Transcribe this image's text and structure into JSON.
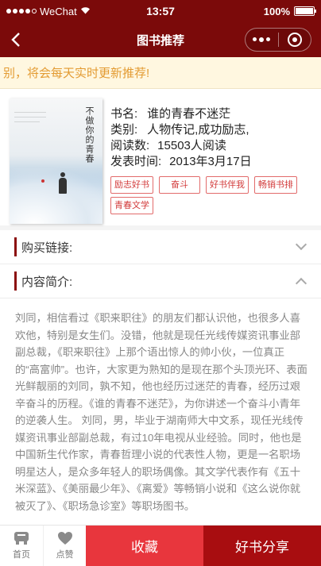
{
  "status_bar": {
    "carrier": "WeChat",
    "time": "13:57",
    "battery": "100%"
  },
  "nav": {
    "title": "图书推荐"
  },
  "notice": {
    "text": "别，将会每天实时更新推荐!"
  },
  "book": {
    "cover_title": "不做你的青春",
    "title_label": "书名:",
    "title": "谁的青春不迷茫",
    "category_label": "类别:",
    "category": "人物传记,成功励志,",
    "reads_label": "阅读数:",
    "reads": "15503人阅读",
    "date_label": "发表时间:",
    "date": "2013年3月17日",
    "tags": [
      "励志好书",
      "奋斗",
      "好书伴我",
      "畅销书排",
      "青春文学"
    ]
  },
  "sections": {
    "buy": "购买链接:",
    "intro": "内容简介:"
  },
  "summary": "刘同，相信看过《职来职往》的朋友们都认识他，也很多人喜欢他，特别是女生们。没错，他就是现任光线传媒资讯事业部副总裁，《职来职往》上那个语出惊人的帅小伙，一位真正的“高富帅”。也许，大家更为熟知的是现在那个头顶光环、表面光鲜靓丽的刘同，孰不知，他也经历过迷茫的青春，经历过艰辛奋斗的历程。《谁的青春不迷茫》，为你讲述一个奋斗小青年的逆袭人生。 刘同，男，毕业于湖南师大中文系，现任光线传媒资讯事业部副总裁，有过10年电视从业经验。同时，他也是中国新生代作家，青春哲理小说的代表性人物，更是一名职场明星达人，是众多年轻人的职场偶像。其文学代表作有《五十米深蓝》、《美丽最少年》、《离爱》等畅销小说和《这么说你就被灭了》、《职场急诊室》等职场图书。",
  "bottom": {
    "home": "首页",
    "like": "点赞",
    "favorite": "收藏",
    "share": "好书分享"
  },
  "colors": {
    "theme": "#7b0a0a",
    "favorite": "#e8363d",
    "share": "#a80d10",
    "notice_text": "#e39b32"
  }
}
